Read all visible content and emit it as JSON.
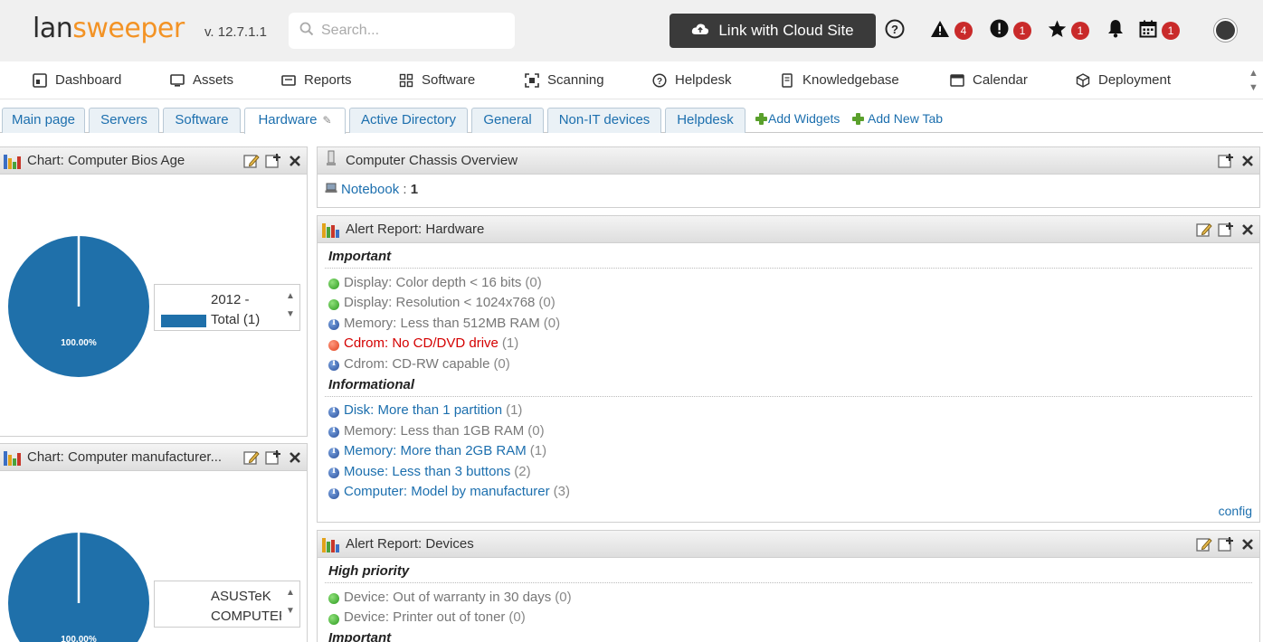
{
  "header": {
    "logo_part1": "lan",
    "logo_part2": "sweeper",
    "version": "v. 12.7.1.1",
    "search_placeholder": "Search...",
    "cloud_button": "Link with Cloud Site",
    "badges": {
      "warnings": "4",
      "alerts": "1",
      "favorites": "1",
      "calendar": "1"
    }
  },
  "nav": [
    {
      "label": "Dashboard",
      "icon": "dashboard-icon"
    },
    {
      "label": "Assets",
      "icon": "monitor-icon"
    },
    {
      "label": "Reports",
      "icon": "reports-icon"
    },
    {
      "label": "Software",
      "icon": "grid-icon"
    },
    {
      "label": "Scanning",
      "icon": "scan-icon"
    },
    {
      "label": "Helpdesk",
      "icon": "help-icon"
    },
    {
      "label": "Knowledgebase",
      "icon": "book-icon"
    },
    {
      "label": "Calendar",
      "icon": "calendar-icon"
    },
    {
      "label": "Deployment",
      "icon": "cube-icon"
    }
  ],
  "tabs": [
    "Main page",
    "Servers",
    "Software",
    "Hardware",
    "Active Directory",
    "General",
    "Non-IT devices",
    "Helpdesk"
  ],
  "active_tab": "Hardware",
  "tab_actions": {
    "add_widgets": "Add Widgets",
    "add_new_tab": "Add New Tab"
  },
  "widgets": {
    "bios_chart": {
      "title": "Chart: Computer Bios Age",
      "legend_line1": "2012 -",
      "legend_line2": "Total (1)",
      "slice_label": "100.00%"
    },
    "manufacturer_chart": {
      "title": "Chart: Computer manufacturer...",
      "legend_line1": "ASUSTeK",
      "legend_line2": "COMPUTER",
      "slice_label": "100.00%"
    },
    "chassis": {
      "title": "Computer Chassis Overview",
      "item_label": "Notebook",
      "item_sep": " : ",
      "item_count": "1"
    },
    "alert_hardware": {
      "title": "Alert Report: Hardware",
      "sections": [
        {
          "name": "Important",
          "items": [
            {
              "text": "Display: Color depth < 16 bits",
              "count": "(0)",
              "status": "green",
              "style": "gray"
            },
            {
              "text": "Display: Resolution < 1024x768",
              "count": "(0)",
              "status": "green",
              "style": "gray"
            },
            {
              "text": "Memory: Less than 512MB RAM",
              "count": "(0)",
              "status": "info",
              "style": "gray"
            },
            {
              "text": "Cdrom: No CD/DVD drive",
              "count": "(1)",
              "status": "red",
              "style": "red"
            },
            {
              "text": "Cdrom: CD-RW capable",
              "count": "(0)",
              "status": "info",
              "style": "gray"
            }
          ]
        },
        {
          "name": "Informational",
          "items": [
            {
              "text": "Disk: More than 1 partition",
              "count": "(1)",
              "status": "info",
              "style": "link"
            },
            {
              "text": "Memory: Less than 1GB RAM",
              "count": "(0)",
              "status": "info",
              "style": "gray"
            },
            {
              "text": "Memory: More than 2GB RAM",
              "count": "(1)",
              "status": "info",
              "style": "link"
            },
            {
              "text": "Mouse: Less than 3 buttons",
              "count": "(2)",
              "status": "info",
              "style": "link"
            },
            {
              "text": "Computer: Model by manufacturer",
              "count": "(3)",
              "status": "info",
              "style": "link"
            }
          ]
        }
      ],
      "config_label": "config"
    },
    "alert_devices": {
      "title": "Alert Report: Devices",
      "sections": [
        {
          "name": "High priority",
          "items": [
            {
              "text": "Device: Out of warranty in 30 days",
              "count": "(0)",
              "status": "green",
              "style": "gray"
            },
            {
              "text": "Device: Printer out of toner",
              "count": "(0)",
              "status": "green",
              "style": "gray"
            }
          ]
        },
        {
          "name": "Important",
          "items": []
        }
      ]
    }
  },
  "colors": {
    "accent": "#1c6fae",
    "logo_orange": "#f39325",
    "pie": "#1f70aa",
    "badge": "#c92a2a",
    "alert_red": "#d40000"
  }
}
